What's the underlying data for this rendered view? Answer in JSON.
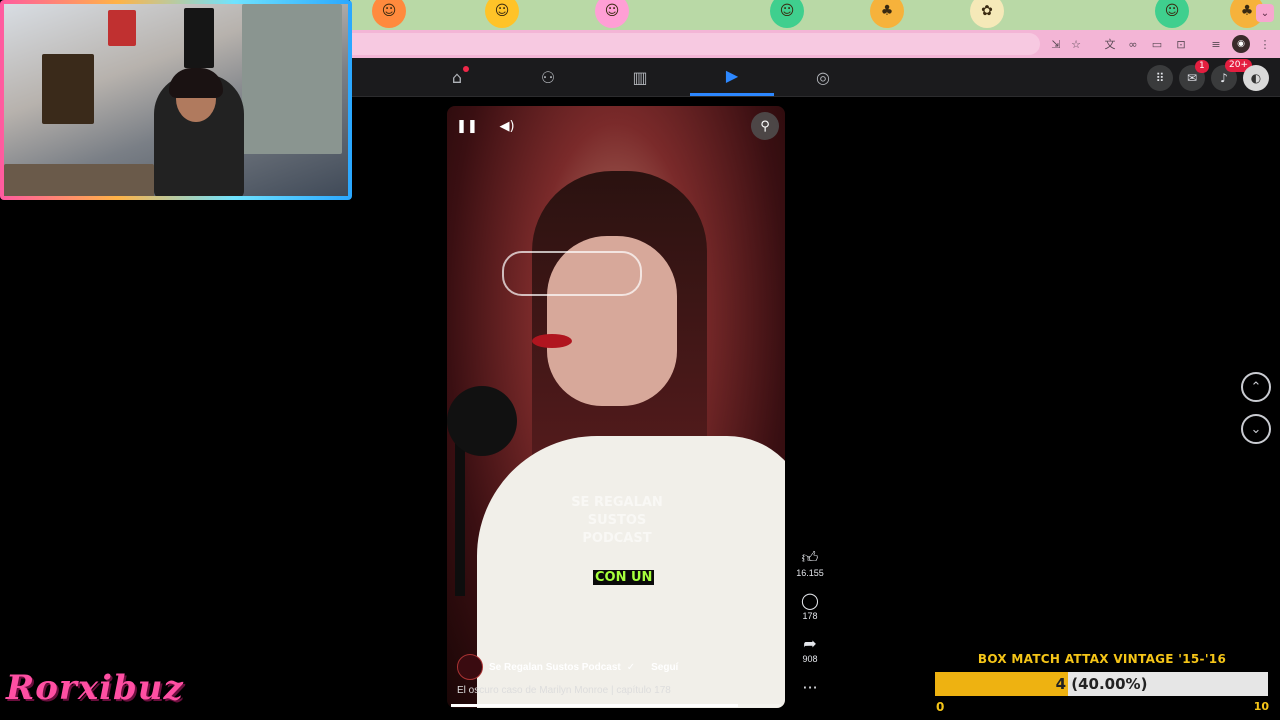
{
  "browser": {
    "toolbar_icons": [
      "install-icon",
      "star-icon",
      "translate-icon",
      "link-icon",
      "reader-icon",
      "cast-icon",
      "extensions-icon",
      "profile-icon",
      "menu-icon"
    ]
  },
  "facebook_nav": {
    "tabs": [
      {
        "name": "home",
        "icon": "⌂",
        "active": false,
        "has_dot": true
      },
      {
        "name": "friends",
        "icon": "⚇",
        "active": false,
        "has_dot": false
      },
      {
        "name": "dashboard",
        "icon": "▥",
        "active": false,
        "has_dot": false
      },
      {
        "name": "video",
        "icon": "▶",
        "active": true,
        "has_dot": false
      },
      {
        "name": "groups",
        "icon": "◎",
        "active": false,
        "has_dot": false
      }
    ],
    "messenger_badge": "1",
    "notifications_badge": "20+"
  },
  "reel": {
    "watermark_line1": "SE REGALAN SUSTOS",
    "watermark_line2": "PODCAST",
    "caption": "CON UN",
    "channel_name": "Se Regalan Sustos Podcast",
    "verified_icon": "✓",
    "follow_label": "Seguí",
    "description": "El oscuro caso de Marilyn Monroe | capítulo 178",
    "progress": 0.87
  },
  "actions": {
    "likes": "16.155",
    "comments": "178",
    "shares": "908",
    "more": "···"
  },
  "overlay": {
    "streamer_logo": "Rorxibuz",
    "box_match": {
      "title": "BOX MATCH ATTAX VINTAGE '15-'16",
      "current": "4",
      "percent": "(40.00%)",
      "fraction": 0.4,
      "min": "0",
      "max": "10"
    }
  },
  "colors": {
    "fb_blue": "#2d88ff",
    "badge_red": "#e41e3f",
    "caption_green": "#a6ff3c",
    "bar_gold": "#eeb211"
  }
}
